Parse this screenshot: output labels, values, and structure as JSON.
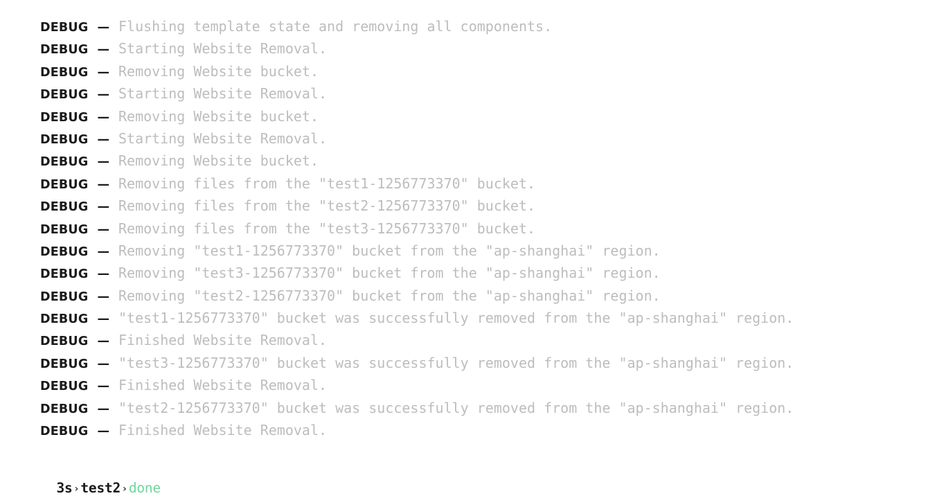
{
  "log": {
    "level_label": "DEBUG",
    "separator": "—",
    "lines": [
      {
        "level": "DEBUG",
        "message": "Flushing template state and removing all components."
      },
      {
        "level": "DEBUG",
        "message": "Starting Website Removal."
      },
      {
        "level": "DEBUG",
        "message": "Removing Website bucket."
      },
      {
        "level": "DEBUG",
        "message": "Starting Website Removal."
      },
      {
        "level": "DEBUG",
        "message": "Removing Website bucket."
      },
      {
        "level": "DEBUG",
        "message": "Starting Website Removal."
      },
      {
        "level": "DEBUG",
        "message": "Removing Website bucket."
      },
      {
        "level": "DEBUG",
        "message": "Removing files from the \"test1-1256773370\" bucket."
      },
      {
        "level": "DEBUG",
        "message": "Removing files from the \"test2-1256773370\" bucket."
      },
      {
        "level": "DEBUG",
        "message": "Removing files from the \"test3-1256773370\" bucket."
      },
      {
        "level": "DEBUG",
        "message": "Removing \"test1-1256773370\" bucket from the \"ap-shanghai\" region."
      },
      {
        "level": "DEBUG",
        "message": "Removing \"test3-1256773370\" bucket from the \"ap-shanghai\" region."
      },
      {
        "level": "DEBUG",
        "message": "Removing \"test2-1256773370\" bucket from the \"ap-shanghai\" region."
      },
      {
        "level": "DEBUG",
        "message": "\"test1-1256773370\" bucket was successfully removed from the \"ap-shanghai\" region."
      },
      {
        "level": "DEBUG",
        "message": "Finished Website Removal."
      },
      {
        "level": "DEBUG",
        "message": "\"test3-1256773370\" bucket was successfully removed from the \"ap-shanghai\" region."
      },
      {
        "level": "DEBUG",
        "message": "Finished Website Removal."
      },
      {
        "level": "DEBUG",
        "message": "\"test2-1256773370\" bucket was successfully removed from the \"ap-shanghai\" region."
      },
      {
        "level": "DEBUG",
        "message": "Finished Website Removal."
      }
    ]
  },
  "status": {
    "duration": "3s",
    "target": "test2",
    "state": "done",
    "chevron": "›"
  },
  "colors": {
    "background": "#ffffff",
    "level_text": "#1b1b1b",
    "message_text": "#bdbdbd",
    "status_text": "#1b1b1b",
    "done_text": "#6ed69b"
  }
}
